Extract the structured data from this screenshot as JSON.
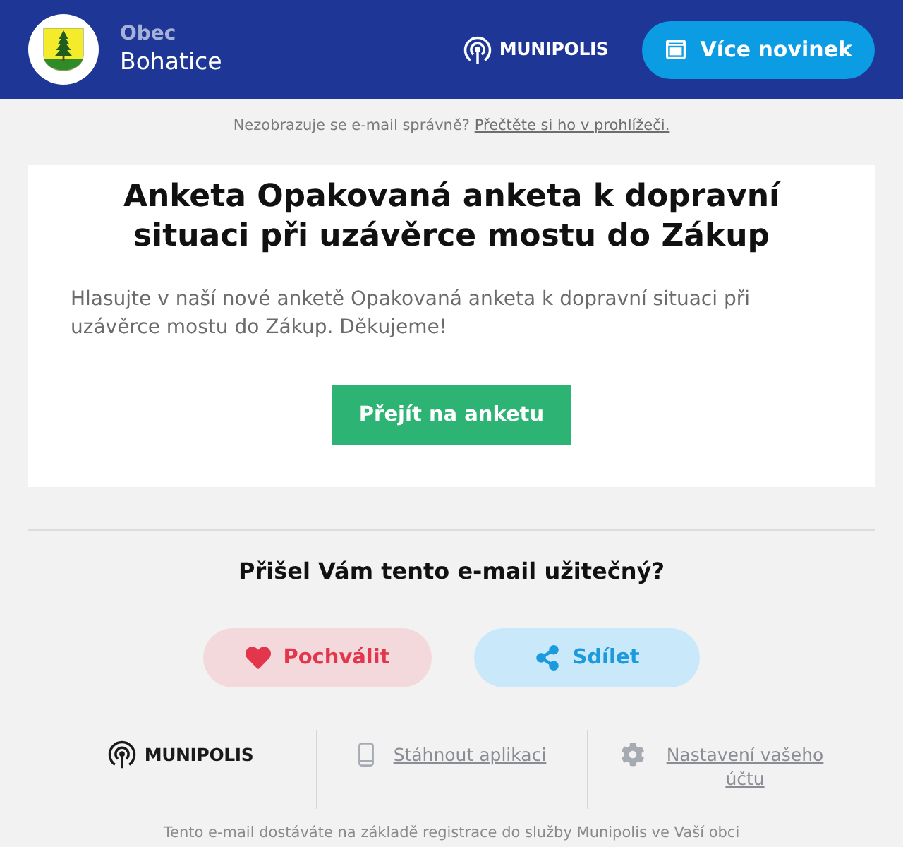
{
  "header": {
    "municipality": {
      "type": "Obec",
      "name": "Bohatice"
    },
    "brand": "MUNIPOLIS",
    "button": "Více novinek"
  },
  "preheader": {
    "text": "Nezobrazuje se e-mail správně?",
    "link": "Přečtěte si ho v prohlížeči."
  },
  "article": {
    "title": "Anketa Opakovaná anketa k dopravní situaci při uzávěrce mostu do Zákup",
    "body": "Hlasujte v naší nové anketě Opakovaná anketa k dopravní situaci při uzávěrce mostu do Zákup. Děkujeme!",
    "button": "Přejít na anketu"
  },
  "feedback": {
    "question": "Přišel Vám tento e-mail užitečný?",
    "buttons": [
      {
        "kind": "like",
        "label": "Pochválit"
      },
      {
        "kind": "share",
        "label": "Sdílet"
      }
    ]
  },
  "footer": {
    "brand": "MUNIPOLIS",
    "links": [
      {
        "kind": "app",
        "label": "Stáhnout aplikaci"
      },
      {
        "kind": "settings",
        "label": "Nastavení vašeho účtu"
      }
    ],
    "note": "Tento e-mail dostáváte na základě registrace do služby Munipolis ve Vaší obci"
  }
}
